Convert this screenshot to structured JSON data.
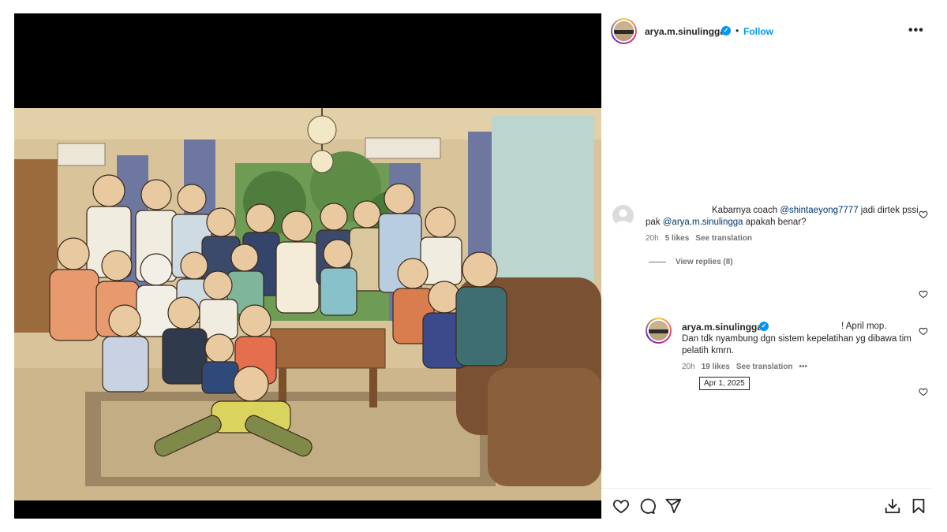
{
  "post": {
    "username": "arya.m.sinulingga",
    "verified_icon": "verified-badge-icon",
    "separator": "•",
    "follow_label": "Follow",
    "more_icon": "more-options-icon",
    "more_label": "•••"
  },
  "comments": [
    {
      "text_before": "Kabarnya coach ",
      "mention1": "@shintaeyong7777",
      "text_middle": " jadi dirtek pssi pak ",
      "mention2": "@arya.m.sinulingga",
      "text_after": " apakah benar?",
      "time": "20h",
      "likes": "5 likes",
      "translate": "See translation",
      "view_replies": "View replies (8)"
    }
  ],
  "reply": {
    "username": "arya.m.sinulingga",
    "text_line1": "! April mop.",
    "text_rest": "Dan tdk nyambung dgn sistem kepelatihan yg dibawa tim pelatih kmrn.",
    "time": "20h",
    "likes": "19 likes",
    "translate": "See translation",
    "more": "•••",
    "tooltip": "Apr 1, 2025"
  },
  "actions": [
    "like-icon",
    "comment-icon",
    "share-icon",
    "download-icon",
    "save-icon"
  ],
  "colors": {
    "accent": "#0095f6",
    "mention": "#00376b",
    "meta": "#737373"
  }
}
